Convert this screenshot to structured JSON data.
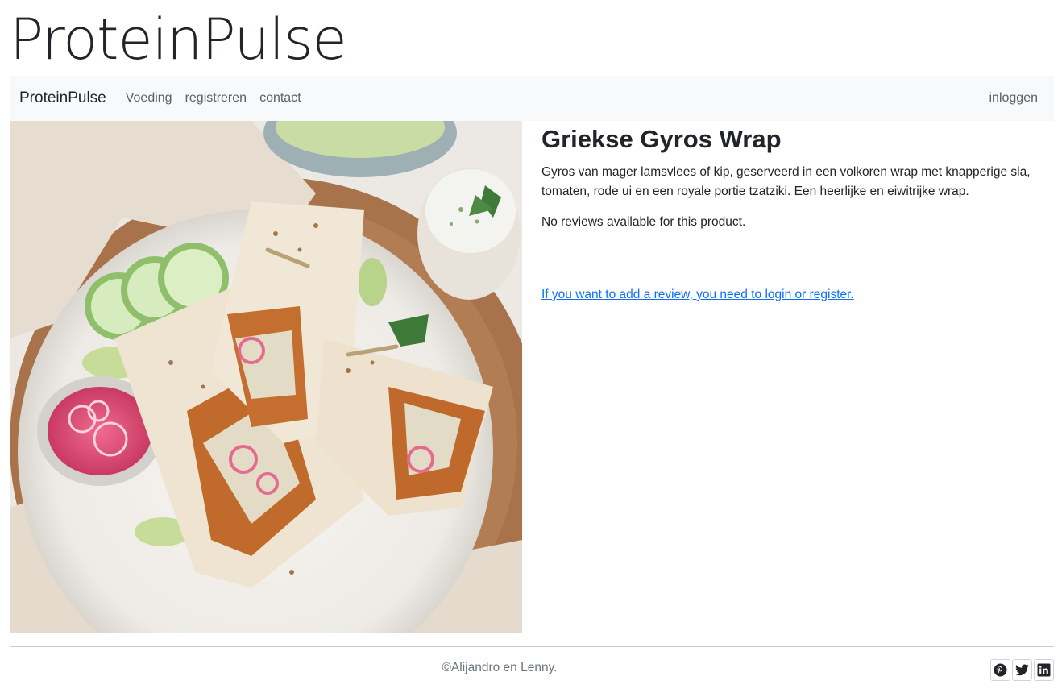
{
  "site": {
    "title": "ProteinPulse"
  },
  "navbar": {
    "brand": "ProteinPulse",
    "links": [
      "Voeding",
      "registreren",
      "contact"
    ],
    "login": "inloggen"
  },
  "product": {
    "title": "Griekse Gyros Wrap",
    "description": "Gyros van mager lamsvlees of kip, geserveerd in een volkoren wrap met knapperige sla, tomaten, rode ui en een royale portie tzatziki. Een heerlijke en eiwitrijke wrap.",
    "no_reviews": "No reviews available for this product.",
    "review_prompt": "If you want to add a review, you need to login or register."
  },
  "footer": {
    "copyright": "©Alijandro en Lenny.",
    "socials": [
      "pinterest-icon",
      "twitter-icon",
      "linkedin-icon"
    ]
  },
  "colors": {
    "navbar_bg": "#f8f9fa",
    "link": "#0d6efd"
  }
}
